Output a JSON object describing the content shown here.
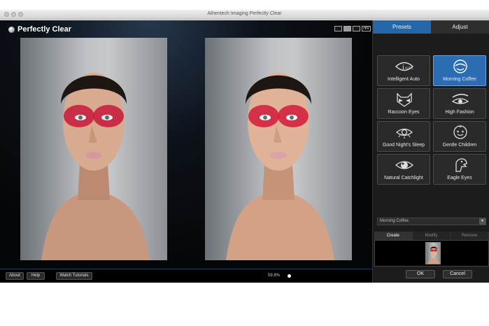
{
  "window": {
    "title": "Athentech Imaging Perfectly Clear"
  },
  "app": {
    "logo_text": "Perfectly Clear"
  },
  "view_toolbar": {
    "hv_label": "H/V",
    "buttons": [
      "single-view-icon",
      "side-by-side-icon",
      "split-view-icon"
    ]
  },
  "panel": {
    "tabs": [
      {
        "label": "Presets",
        "active": true
      },
      {
        "label": "Adjust",
        "active": false
      }
    ],
    "presets": [
      {
        "label": "Intelligent Auto",
        "icon": "intelligent-auto-icon",
        "selected": false
      },
      {
        "label": "Morning Coffee",
        "icon": "morning-coffee-icon",
        "selected": true
      },
      {
        "label": "Raccoon Eyes",
        "icon": "raccoon-icon",
        "selected": false
      },
      {
        "label": "High Fashion",
        "icon": "high-fashion-eye-icon",
        "selected": false
      },
      {
        "label": "Good Night's Sleep",
        "icon": "sleep-eye-icon",
        "selected": false
      },
      {
        "label": "Gentle Children",
        "icon": "child-face-icon",
        "selected": false
      },
      {
        "label": "Natural Catchlight",
        "icon": "catchlight-eye-icon",
        "selected": false
      },
      {
        "label": "Eagle Eyes",
        "icon": "eagle-icon",
        "selected": false
      }
    ],
    "preset_dropdown": {
      "value": "Morning Coffee"
    },
    "subtabs": [
      {
        "label": "Create",
        "active": true
      },
      {
        "label": "Modify",
        "active": false
      },
      {
        "label": "Remove",
        "active": false
      }
    ],
    "ok_label": "OK",
    "cancel_label": "Cancel"
  },
  "bottombar": {
    "about_label": "About",
    "help_label": "Help",
    "tutorials_label": "Watch Tutorials",
    "zoom": "59.8%"
  },
  "colors": {
    "accent": "#2566a8",
    "selected_preset": "#2b6cb2",
    "eye_shadow": "#d11a3a"
  }
}
